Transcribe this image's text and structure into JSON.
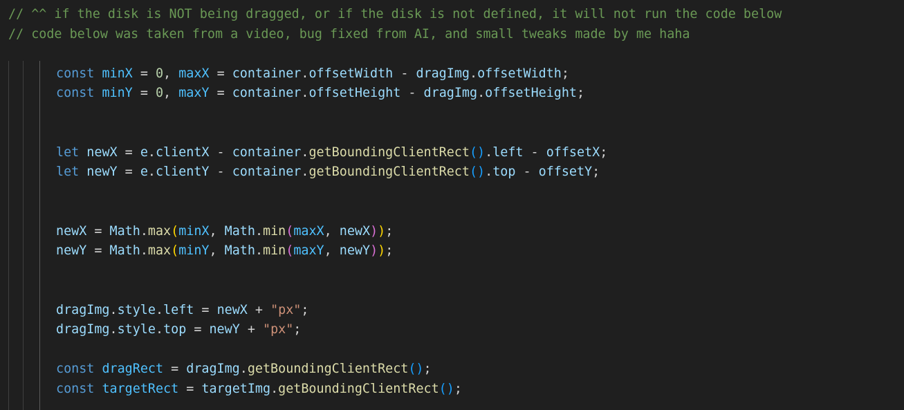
{
  "comments": [
    "// ^^ if the disk is NOT being dragged, or if the disk is not defined, it will not run the code below",
    "// code below was taken from a video, bug fixed from AI, and small tweaks made by me haha"
  ],
  "colors": {
    "background": "#1f1f1f",
    "comment": "#6a9955",
    "keyword": "#569cd6",
    "constant": "#4fc1ff",
    "variable": "#9cdcfe",
    "function": "#dcdcaa",
    "number": "#b5cea8",
    "string": "#ce9178",
    "bracket_level_1": "#179fff",
    "bracket_level_2": "#ffd700"
  },
  "code_lines": [
    {
      "text": "const minX = 0, maxX = container.offsetWidth - dragImg.offsetWidth;",
      "tokens": [
        [
          "const",
          "kw"
        ],
        [
          " ",
          "pu"
        ],
        [
          "minX",
          "cn"
        ],
        [
          " = ",
          "op"
        ],
        [
          "0",
          "nm"
        ],
        [
          ", ",
          "pu"
        ],
        [
          "maxX",
          "cn"
        ],
        [
          " = ",
          "op"
        ],
        [
          "container",
          "vr"
        ],
        [
          ".",
          "pu"
        ],
        [
          "offsetWidth",
          "vr"
        ],
        [
          " - ",
          "op"
        ],
        [
          "dragImg",
          "vr"
        ],
        [
          ".",
          "pu"
        ],
        [
          "offsetWidth",
          "vr"
        ],
        [
          ";",
          "pu"
        ]
      ]
    },
    {
      "text": "const minY = 0, maxY = container.offsetHeight - dragImg.offsetHeight;",
      "tokens": [
        [
          "const",
          "kw"
        ],
        [
          " ",
          "pu"
        ],
        [
          "minY",
          "cn"
        ],
        [
          " = ",
          "op"
        ],
        [
          "0",
          "nm"
        ],
        [
          ", ",
          "pu"
        ],
        [
          "maxY",
          "cn"
        ],
        [
          " = ",
          "op"
        ],
        [
          "container",
          "vr"
        ],
        [
          ".",
          "pu"
        ],
        [
          "offsetHeight",
          "vr"
        ],
        [
          " - ",
          "op"
        ],
        [
          "dragImg",
          "vr"
        ],
        [
          ".",
          "pu"
        ],
        [
          "offsetHeight",
          "vr"
        ],
        [
          ";",
          "pu"
        ]
      ]
    },
    {
      "text": "let newX = e.clientX - container.getBoundingClientRect().left - offsetX;",
      "tokens": [
        [
          "let",
          "kw"
        ],
        [
          " ",
          "pu"
        ],
        [
          "newX",
          "vr"
        ],
        [
          " = ",
          "op"
        ],
        [
          "e",
          "vr"
        ],
        [
          ".",
          "pu"
        ],
        [
          "clientX",
          "vr"
        ],
        [
          " - ",
          "op"
        ],
        [
          "container",
          "vr"
        ],
        [
          ".",
          "pu"
        ],
        [
          "getBoundingClientRect",
          "fn"
        ],
        [
          "()",
          "b1"
        ],
        [
          ".",
          "pu"
        ],
        [
          "left",
          "vr"
        ],
        [
          " - ",
          "op"
        ],
        [
          "offsetX",
          "vr"
        ],
        [
          ";",
          "pu"
        ]
      ]
    },
    {
      "text": "let newY = e.clientY - container.getBoundingClientRect().top - offsetY;",
      "tokens": [
        [
          "let",
          "kw"
        ],
        [
          " ",
          "pu"
        ],
        [
          "newY",
          "vr"
        ],
        [
          " = ",
          "op"
        ],
        [
          "e",
          "vr"
        ],
        [
          ".",
          "pu"
        ],
        [
          "clientY",
          "vr"
        ],
        [
          " - ",
          "op"
        ],
        [
          "container",
          "vr"
        ],
        [
          ".",
          "pu"
        ],
        [
          "getBoundingClientRect",
          "fn"
        ],
        [
          "()",
          "b1"
        ],
        [
          ".",
          "pu"
        ],
        [
          "top",
          "vr"
        ],
        [
          " - ",
          "op"
        ],
        [
          "offsetY",
          "vr"
        ],
        [
          ";",
          "pu"
        ]
      ]
    },
    {
      "text": "newX = Math.max(minX, Math.min(maxX, newX));",
      "tokens": [
        [
          "newX",
          "vr"
        ],
        [
          " = ",
          "op"
        ],
        [
          "Math",
          "vr"
        ],
        [
          ".",
          "pu"
        ],
        [
          "max",
          "fn"
        ],
        [
          "(",
          "b2"
        ],
        [
          "minX",
          "cn"
        ],
        [
          ", ",
          "pu"
        ],
        [
          "Math",
          "vr"
        ],
        [
          ".",
          "pu"
        ],
        [
          "min",
          "fn"
        ],
        [
          "(",
          "b3"
        ],
        [
          "maxX",
          "cn"
        ],
        [
          ", ",
          "pu"
        ],
        [
          "newX",
          "vr"
        ],
        [
          ")",
          "b3"
        ],
        [
          ")",
          "b2"
        ],
        [
          ";",
          "pu"
        ]
      ]
    },
    {
      "text": "newY = Math.max(minY, Math.min(maxY, newY));",
      "tokens": [
        [
          "newY",
          "vr"
        ],
        [
          " = ",
          "op"
        ],
        [
          "Math",
          "vr"
        ],
        [
          ".",
          "pu"
        ],
        [
          "max",
          "fn"
        ],
        [
          "(",
          "b2"
        ],
        [
          "minY",
          "cn"
        ],
        [
          ", ",
          "pu"
        ],
        [
          "Math",
          "vr"
        ],
        [
          ".",
          "pu"
        ],
        [
          "min",
          "fn"
        ],
        [
          "(",
          "b3"
        ],
        [
          "maxY",
          "cn"
        ],
        [
          ", ",
          "pu"
        ],
        [
          "newY",
          "vr"
        ],
        [
          ")",
          "b3"
        ],
        [
          ")",
          "b2"
        ],
        [
          ";",
          "pu"
        ]
      ]
    },
    {
      "text": "dragImg.style.left = newX + \"px\";",
      "tokens": [
        [
          "dragImg",
          "vr"
        ],
        [
          ".",
          "pu"
        ],
        [
          "style",
          "vr"
        ],
        [
          ".",
          "pu"
        ],
        [
          "left",
          "vr"
        ],
        [
          " = ",
          "op"
        ],
        [
          "newX",
          "vr"
        ],
        [
          " + ",
          "op"
        ],
        [
          "\"px\"",
          "st"
        ],
        [
          ";",
          "pu"
        ]
      ]
    },
    {
      "text": "dragImg.style.top = newY + \"px\";",
      "tokens": [
        [
          "dragImg",
          "vr"
        ],
        [
          ".",
          "pu"
        ],
        [
          "style",
          "vr"
        ],
        [
          ".",
          "pu"
        ],
        [
          "top",
          "vr"
        ],
        [
          " = ",
          "op"
        ],
        [
          "newY",
          "vr"
        ],
        [
          " + ",
          "op"
        ],
        [
          "\"px\"",
          "st"
        ],
        [
          ";",
          "pu"
        ]
      ]
    },
    {
      "text": "const dragRect = dragImg.getBoundingClientRect();",
      "tokens": [
        [
          "const",
          "kw"
        ],
        [
          " ",
          "pu"
        ],
        [
          "dragRect",
          "cn"
        ],
        [
          " = ",
          "op"
        ],
        [
          "dragImg",
          "vr"
        ],
        [
          ".",
          "pu"
        ],
        [
          "getBoundingClientRect",
          "fn"
        ],
        [
          "()",
          "b1"
        ],
        [
          ";",
          "pu"
        ]
      ]
    },
    {
      "text": "const targetRect = targetImg.getBoundingClientRect();",
      "tokens": [
        [
          "const",
          "kw"
        ],
        [
          " ",
          "pu"
        ],
        [
          "targetRect",
          "cn"
        ],
        [
          " = ",
          "op"
        ],
        [
          "targetImg",
          "vr"
        ],
        [
          ".",
          "pu"
        ],
        [
          "getBoundingClientRect",
          "fn"
        ],
        [
          "()",
          "b1"
        ],
        [
          ";",
          "pu"
        ]
      ]
    }
  ]
}
